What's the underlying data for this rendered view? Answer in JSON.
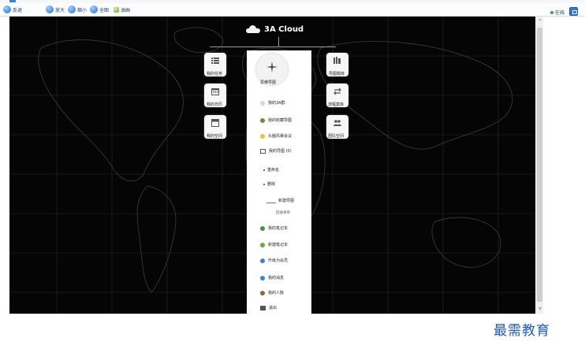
{
  "toolbar": {
    "items": [
      {
        "label": "反退",
        "icon": "back-icon"
      },
      {
        "label": "放大",
        "icon": "zoom-in-icon"
      },
      {
        "label": "缩小",
        "icon": "zoom-out-icon"
      },
      {
        "label": "全图",
        "icon": "fit-view-icon"
      },
      {
        "label": "油画",
        "icon": "paint-icon"
      }
    ],
    "status_label": "在线"
  },
  "mindmap": {
    "root": "3A Cloud",
    "left_nodes": [
      {
        "label": "我的任务",
        "icon": "task-list-icon"
      },
      {
        "label": "我的日历",
        "icon": "calendar-icon"
      },
      {
        "label": "我的空间",
        "icon": "space-icon"
      }
    ],
    "right_nodes": [
      {
        "label": "导图题库",
        "icon": "library-icon"
      },
      {
        "label": "流程案库",
        "icon": "flow-icon"
      },
      {
        "label": "团队空间",
        "icon": "team-icon"
      }
    ],
    "center_label": "思维导图",
    "menu": [
      {
        "label": "我的3A群",
        "icon": "group-icon"
      },
      {
        "label": "我的收藏导图",
        "icon": "favorite-icon"
      },
      {
        "label": "头脑风暴会议",
        "icon": "idea-icon"
      },
      {
        "label": "我的导图 (0)",
        "icon": "folder-icon"
      },
      {
        "label": "重命名",
        "icon": "bullet-icon"
      },
      {
        "label": "删除",
        "icon": "bullet-icon"
      },
      {
        "label": "新建导图",
        "icon": "new-map-icon"
      },
      {
        "label": "回收清单",
        "icon": ""
      },
      {
        "label": "我的笔记本",
        "icon": "notebook-icon"
      },
      {
        "label": "新建笔记本",
        "icon": "add-note-icon"
      },
      {
        "label": "升级为会员",
        "icon": "member-icon"
      },
      {
        "label": "我的消息",
        "icon": "message-icon"
      },
      {
        "label": "我的人脉",
        "icon": "contacts-icon"
      },
      {
        "label": "退出",
        "icon": "logout-icon"
      }
    ]
  },
  "watermark": "最需教育",
  "colors": {
    "canvas_bg": "#050505",
    "toolbar_text": "#1d3c78",
    "watermark": "#1b58c8"
  }
}
